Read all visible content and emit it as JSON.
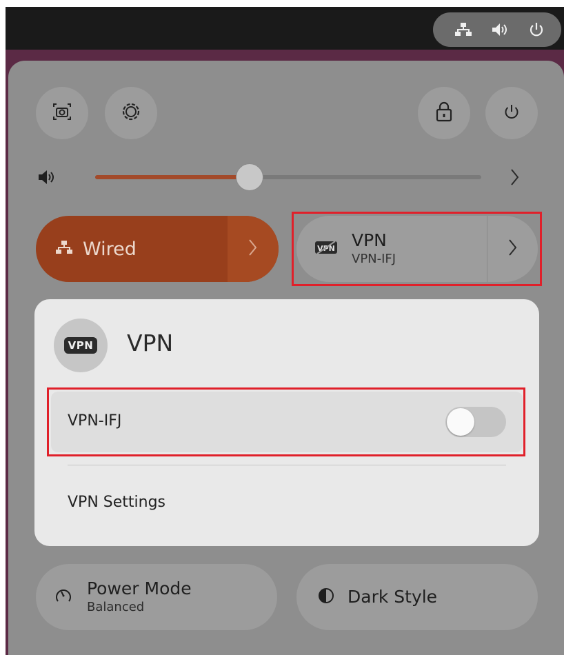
{
  "topbar": {
    "tray_icons": [
      "network-wired-icon",
      "volume-icon",
      "power-icon"
    ]
  },
  "quick_settings": {
    "buttons": [
      "screenshot-icon",
      "settings-icon",
      "lock-icon",
      "power-icon"
    ],
    "volume": {
      "level": 0.4
    },
    "wired": {
      "label": "Wired"
    },
    "vpn": {
      "title": "VPN",
      "subtitle": "VPN-IFJ"
    },
    "power_mode": {
      "title": "Power Mode",
      "subtitle": "Balanced"
    },
    "dark_style": {
      "label": "Dark Style"
    }
  },
  "vpn_menu": {
    "badge": "VPN",
    "title": "VPN",
    "connection": {
      "label": "VPN-IFJ",
      "enabled": false
    },
    "settings_label": "VPN Settings"
  },
  "colors": {
    "accent": "#983f1c",
    "panel": "#8e8e8e",
    "menu": "#e9e9e9",
    "highlight": "#e0202a"
  }
}
